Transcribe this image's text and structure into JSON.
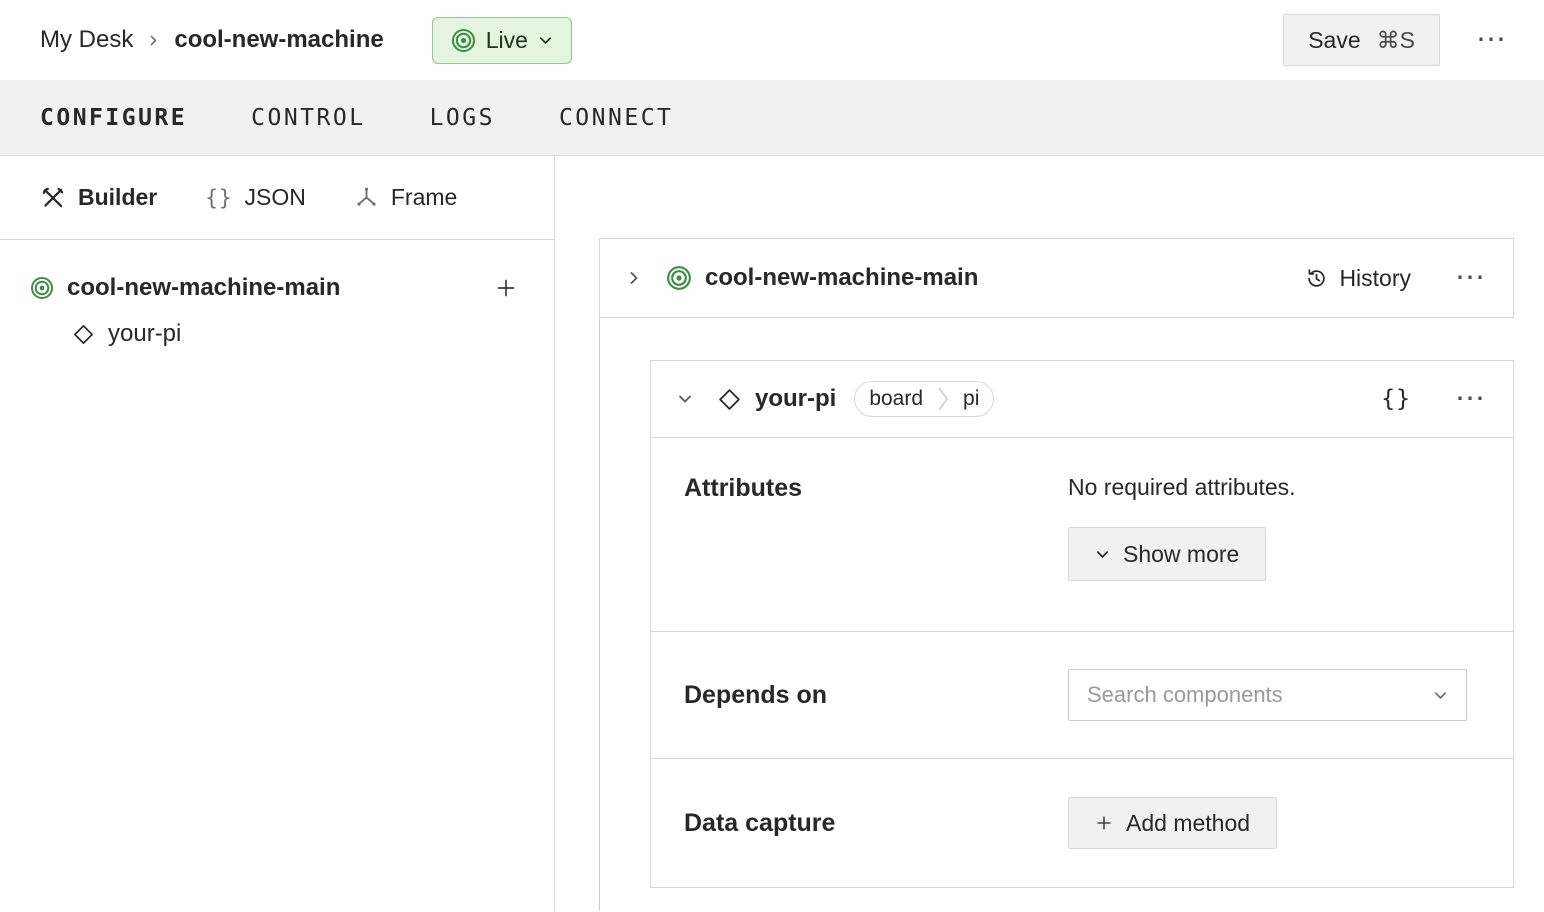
{
  "icons": {
    "ellipsis": "⋯",
    "braces": "{}",
    "viam_target": "concentric-circles",
    "chevron_down": "⌄",
    "chevron_right": "›",
    "diamond": "◇",
    "plus": "+",
    "history": "clock-with-arrow",
    "builder_tools": "crossed-hammer-wrench",
    "frame_axes": "three-axes"
  },
  "colors": {
    "viam_green": "#3d8f44",
    "live_bg": "#e5f4df",
    "live_border": "#8cc98c",
    "card_border": "#d7d7d7",
    "button_bg": "#f1f1f1",
    "tab_bar_bg": "#f1f1f1"
  },
  "header": {
    "breadcrumb": {
      "root": "My Desk",
      "current": "cool-new-machine"
    },
    "live": {
      "label": "Live"
    },
    "save": {
      "label": "Save",
      "shortcut": "⌘S"
    }
  },
  "tabs": {
    "configure": "CONFIGURE",
    "control": "CONTROL",
    "logs": "LOGS",
    "connect": "CONNECT"
  },
  "sidebar": {
    "modes": {
      "builder": "Builder",
      "json": "JSON",
      "frame": "Frame"
    },
    "tree": {
      "part": "cool-new-machine-main",
      "component": "your-pi"
    }
  },
  "main": {
    "part_card": {
      "title": "cool-new-machine-main",
      "history": "History"
    },
    "component": {
      "title": "your-pi",
      "type": "board",
      "model": "pi",
      "attributes_label": "Attributes",
      "attributes_empty": "No required attributes.",
      "show_more": "Show more",
      "depends_label": "Depends on",
      "depends_placeholder": "Search components",
      "capture_label": "Data capture",
      "add_method": "Add method"
    }
  }
}
